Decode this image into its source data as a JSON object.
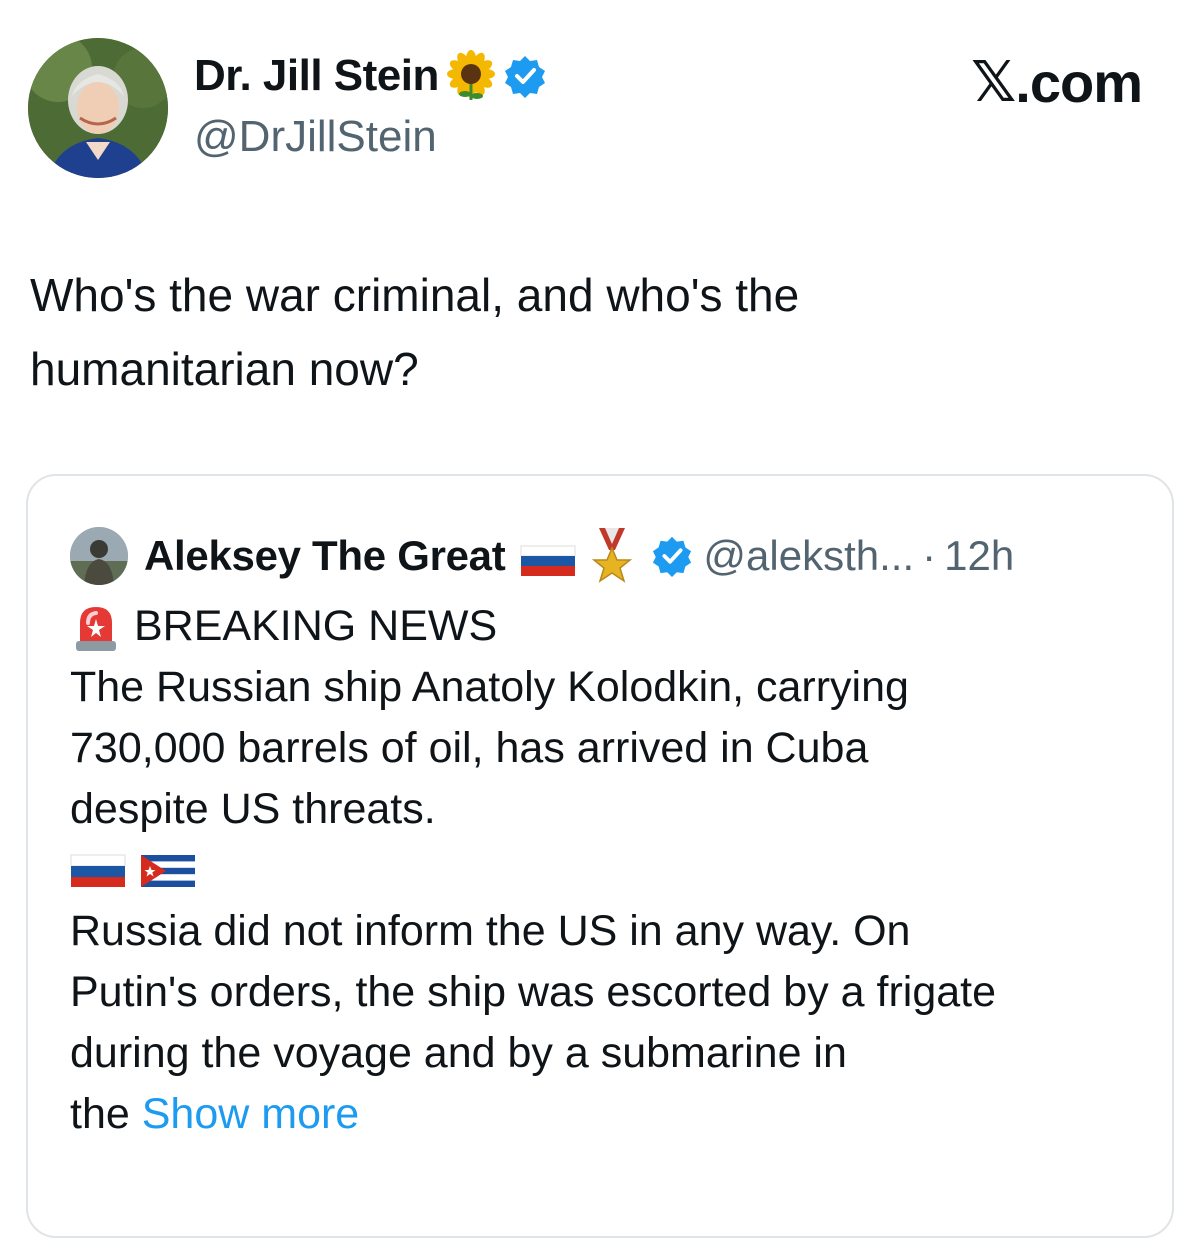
{
  "tweet": {
    "author": {
      "name": "Dr. Jill Stein",
      "name_emoji_icon": "sunflower-icon",
      "verified": true,
      "handle": "@DrJillStein"
    },
    "brand": {
      "text_x": "𝕏",
      "text_rest": ".com"
    },
    "text": "Who's the war criminal, and who's the\nhumanitarian now?",
    "quote": {
      "author": {
        "name": "Aleksey The Great",
        "name_emojis": [
          "russia-flag-icon",
          "military-medal-icon"
        ],
        "verified": true,
        "handle": "@aleksth...",
        "separator": "·",
        "time": "12h"
      },
      "lines": {
        "breaking": "BREAKING NEWS",
        "p1_l1": "The Russian ship Anatoly Kolodkin, carrying",
        "p1_l2": "730,000 barrels of oil, has arrived in Cuba",
        "p1_l3": "despite US threats.",
        "p2_l1": "Russia did not inform the US in any way. On",
        "p2_l2": "Putin's orders, the ship was escorted by a frigate",
        "p2_l3": "during the voyage and by a submarine in",
        "p2_l4_prefix": "the"
      },
      "show_more": "Show more",
      "flag_icons": [
        "russia-flag-icon",
        "cuba-flag-icon"
      ],
      "siren_icon": "rotating-light-icon"
    }
  },
  "colors": {
    "text": "#0f1419",
    "secondary": "#536471",
    "link": "#1d9bf0",
    "verified": "#1d9bf0",
    "border": "#dfe4e8"
  }
}
